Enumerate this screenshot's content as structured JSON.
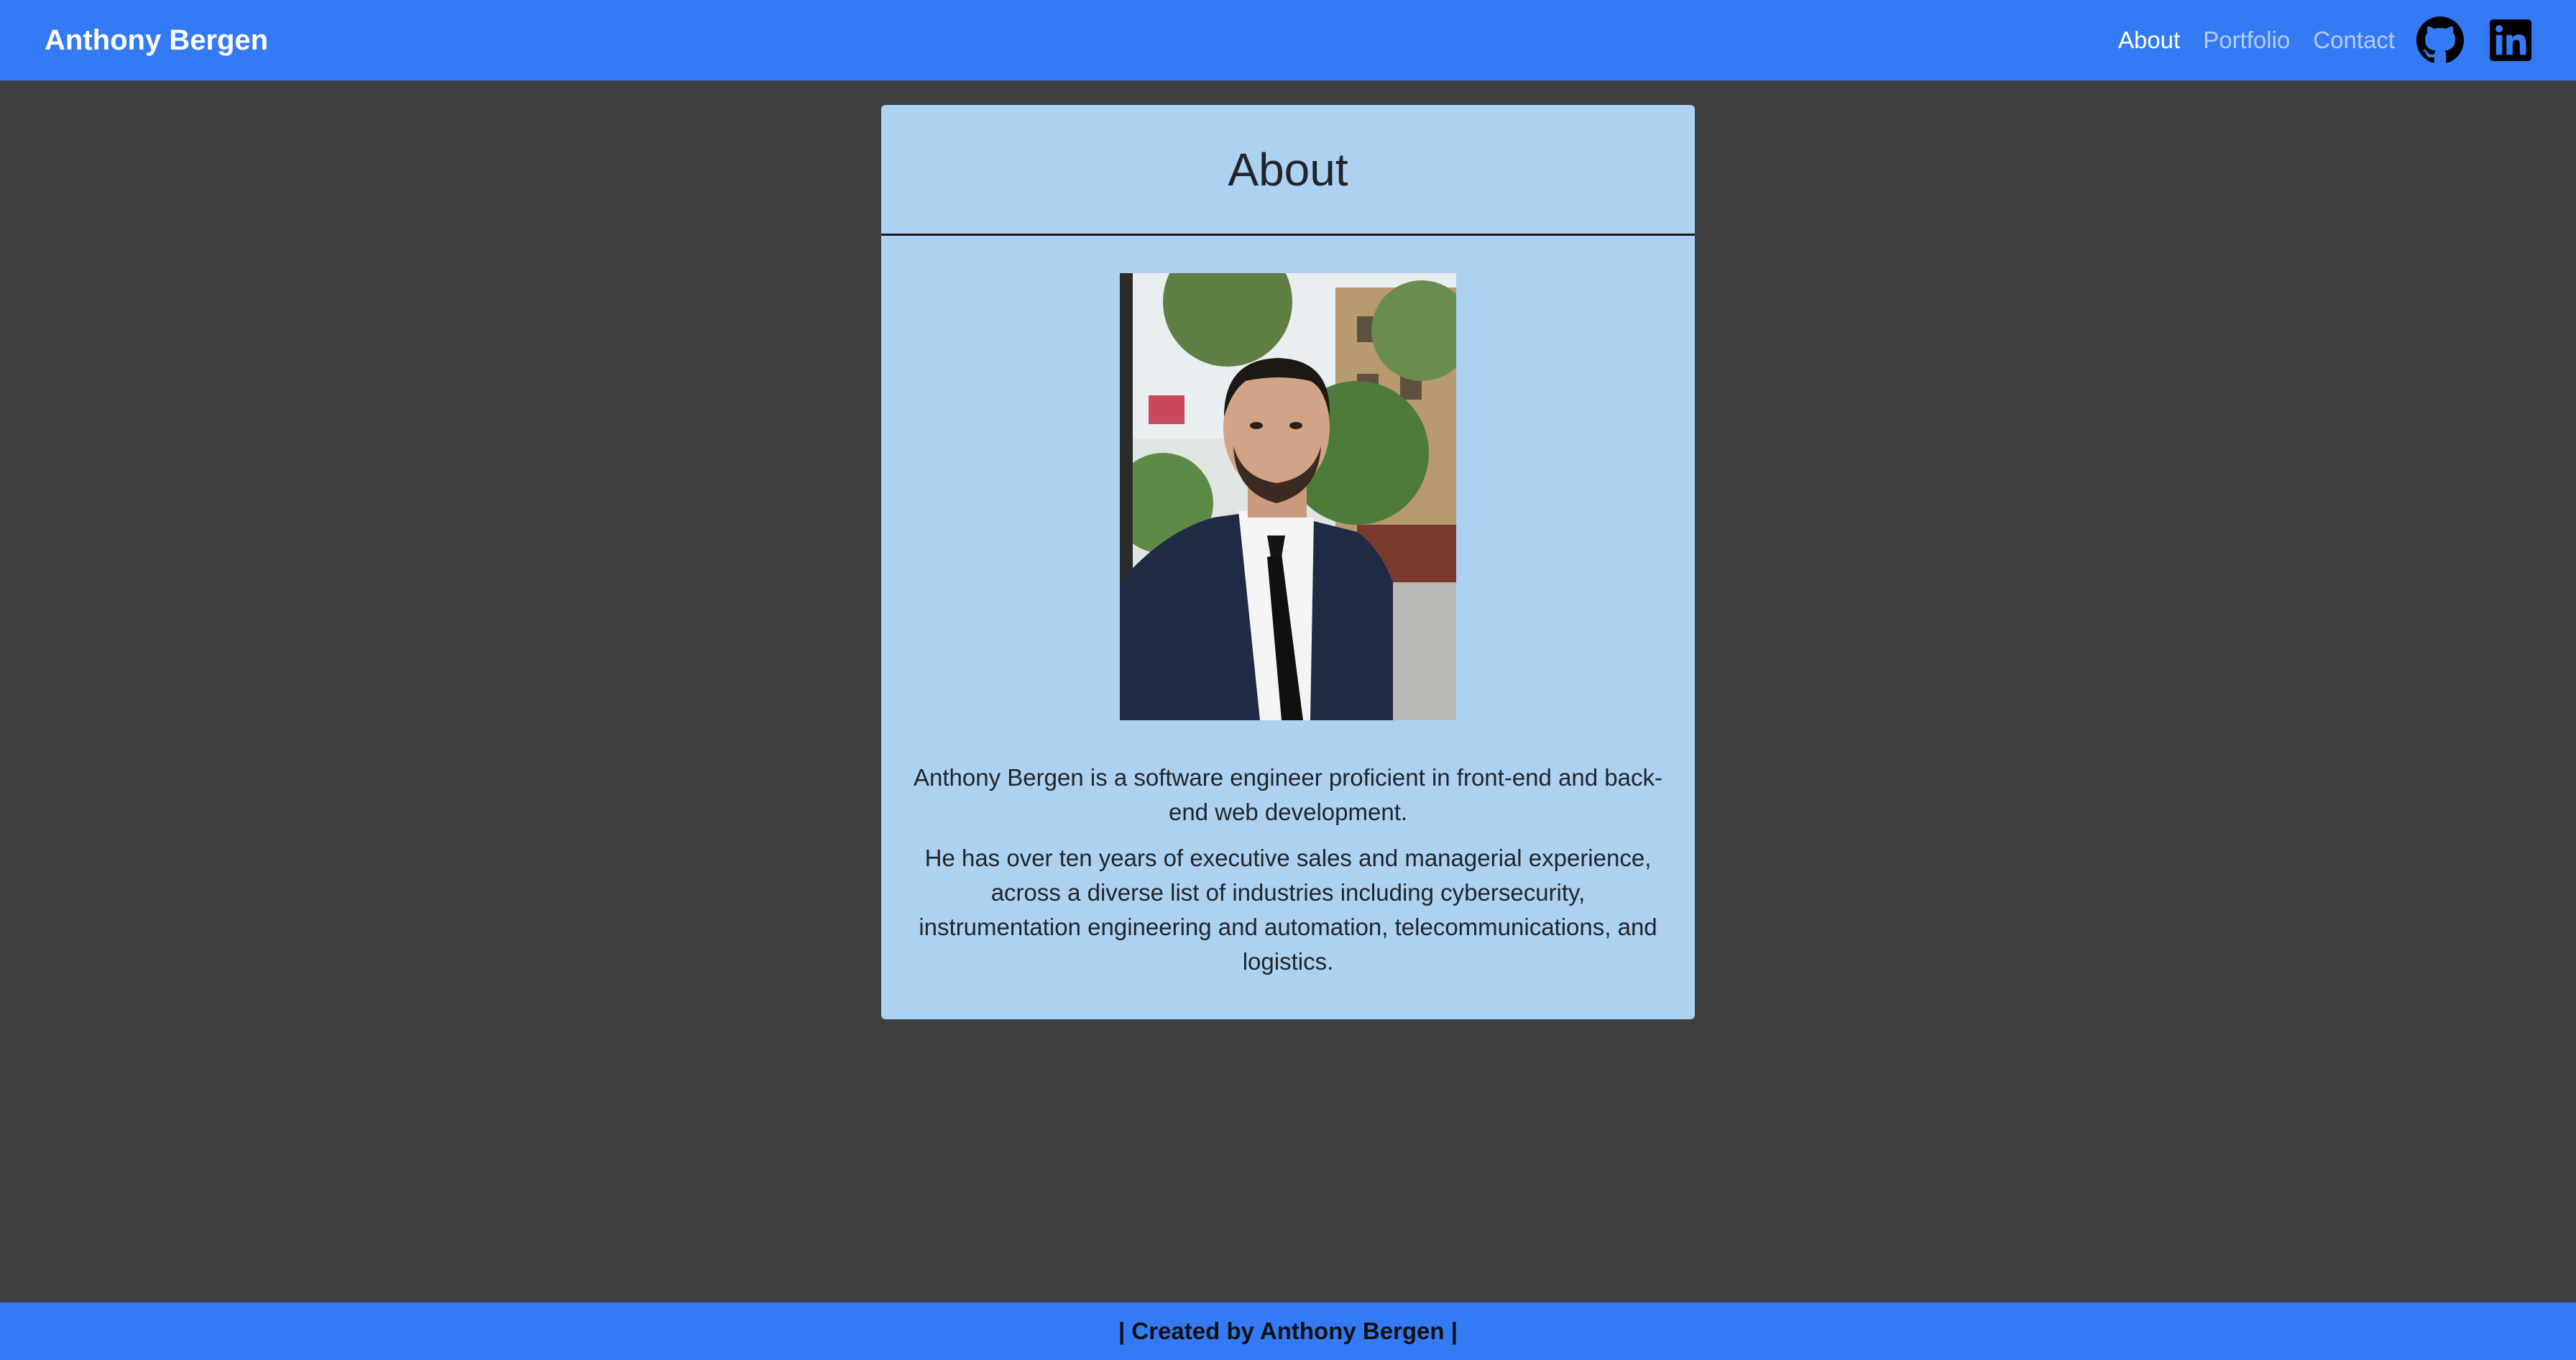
{
  "navbar": {
    "brand": "Anthony Bergen",
    "links": [
      {
        "label": "About",
        "active": true
      },
      {
        "label": "Portfolio",
        "active": false
      },
      {
        "label": "Contact",
        "active": false
      }
    ],
    "icons": [
      "github-icon",
      "linkedin-icon"
    ]
  },
  "about": {
    "title": "About",
    "photo_description": "portrait-photo",
    "paragraphs": [
      "Anthony Bergen is a software engineer proficient in front-end and back-end web development.",
      "He has over ten years of executive sales and managerial experience, across a diverse list of industries including cybersecurity, instrumentation engineering and automation, telecommunications, and logistics."
    ]
  },
  "footer": {
    "text": "| Created by Anthony Bergen |"
  },
  "colors": {
    "accent": "#357af5",
    "background": "#404040",
    "card": "#add1f1"
  }
}
